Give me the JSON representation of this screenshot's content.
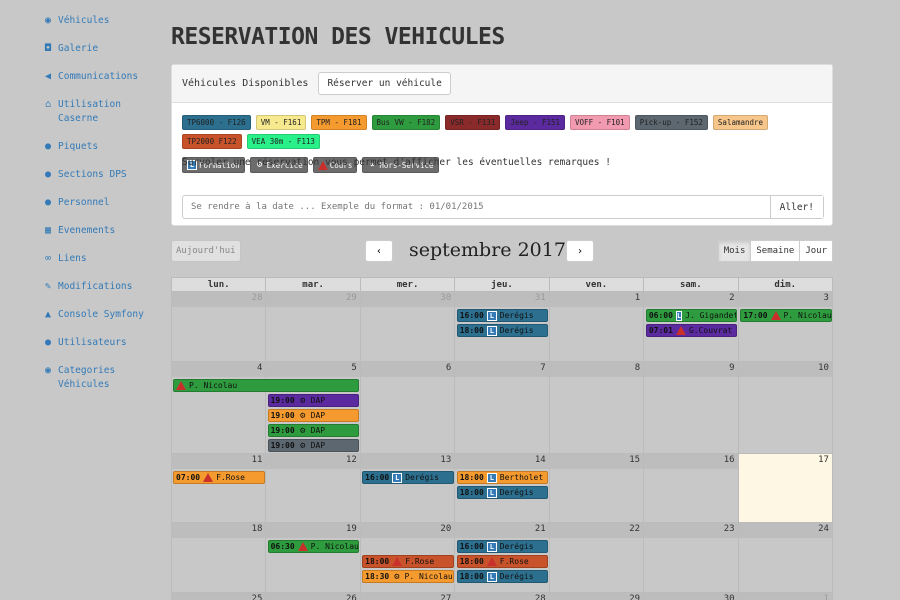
{
  "sidebar": {
    "items": [
      {
        "icon": "circle-icon",
        "glyph": "◉",
        "label": "Véhicules"
      },
      {
        "icon": "camera-icon",
        "glyph": "◘",
        "label": "Galerie"
      },
      {
        "icon": "bullhorn-icon",
        "glyph": "◀",
        "label": "Communications"
      },
      {
        "icon": "home-icon",
        "glyph": "⌂",
        "label": "Utilisation Caserne"
      },
      {
        "icon": "alert-icon",
        "glyph": "●",
        "label": "Piquets"
      },
      {
        "icon": "user-icon",
        "glyph": "●",
        "label": "Sections DPS"
      },
      {
        "icon": "user-icon",
        "glyph": "●",
        "label": "Personnel"
      },
      {
        "icon": "calendar-icon",
        "glyph": "▦",
        "label": "Evenements"
      },
      {
        "icon": "link-icon",
        "glyph": "∞",
        "label": "Liens"
      },
      {
        "icon": "pencil-icon",
        "glyph": "✎",
        "label": "Modifications"
      },
      {
        "icon": "road-icon",
        "glyph": "▲",
        "label": "Console Symfony"
      },
      {
        "icon": "user-icon",
        "glyph": "●",
        "label": "Utilisateurs"
      },
      {
        "icon": "circle-icon",
        "glyph": "◉",
        "label": "Categories Véhicules"
      }
    ]
  },
  "page": {
    "title": "RESERVATION DES VEHICULES"
  },
  "panel": {
    "title": "Véhicules Disponibles",
    "reserve_button": "Réserver un véhicule",
    "vehicles": [
      {
        "label": "TP6000 - F126",
        "color": "#2c6f8f"
      },
      {
        "label": "VM - F161",
        "color": "#f7e98e"
      },
      {
        "label": "TPM - F181",
        "color": "#f59a2e"
      },
      {
        "label": "Bus VW - F182",
        "color": "#2e9c3e"
      },
      {
        "label": "VSR - F131",
        "color": "#8b2a2a"
      },
      {
        "label": "Jeep - F151",
        "color": "#5b2a9e"
      },
      {
        "label": "VOFF - F101",
        "color": "#f29bb0"
      },
      {
        "label": "Pick-up - F152",
        "color": "#5c6770"
      },
      {
        "label": "Salamandre",
        "color": "#f7c68a"
      },
      {
        "label": "TP2000 F122",
        "color": "#c8532b"
      },
      {
        "label": "VEA 30m - F113",
        "color": "#2af08a"
      }
    ],
    "types": [
      {
        "label": "Formation",
        "icon": "L"
      },
      {
        "label": "Exercice",
        "icon": "gear"
      },
      {
        "label": "Cours",
        "icon": "tri"
      },
      {
        "label": "Hors-Service",
        "icon": "x"
      }
    ],
    "hint": "Survoler une réservation vous permet d'afficher les éventuelles remarques !",
    "goto_placeholder": "Se rendre à la date ... Exemple du format : 01/01/2015",
    "goto_button": "Aller!"
  },
  "toolbar": {
    "today": "Aujourd'hui",
    "prev": "‹",
    "next": "›",
    "month": "septembre 2017",
    "views": [
      "Mois",
      "Semaine",
      "Jour"
    ],
    "active_view": "Mois"
  },
  "calendar": {
    "weekdays": [
      "lun.",
      "mar.",
      "mer.",
      "jeu.",
      "ven.",
      "sam.",
      "dim."
    ],
    "weeks": [
      {
        "days": [
          "28",
          "29",
          "30",
          "31",
          "1",
          "2",
          "3"
        ],
        "other": [
          0,
          1,
          2,
          3
        ],
        "events": [
          {
            "day": 3,
            "row": 0,
            "span": 1,
            "time": "16:00",
            "icon": "L",
            "text": "Derégis",
            "color": "#2c6f8f"
          },
          {
            "day": 3,
            "row": 1,
            "span": 1,
            "time": "18:00",
            "icon": "L",
            "text": "Derégis",
            "color": "#2c6f8f"
          },
          {
            "day": 5,
            "row": 0,
            "span": 1,
            "time": "06:00",
            "icon": "L",
            "text": "J. Gigandet",
            "color": "#2e9c3e"
          },
          {
            "day": 5,
            "row": 1,
            "span": 1,
            "time": "07:01",
            "icon": "tri",
            "text": "G.Couvrat",
            "color": "#5b2a9e"
          },
          {
            "day": 6,
            "row": 0,
            "span": 1,
            "time": "17:00",
            "icon": "tri",
            "text": "P. Nicolau",
            "color": "#2e9c3e"
          }
        ]
      },
      {
        "days": [
          "4",
          "5",
          "6",
          "7",
          "8",
          "9",
          "10"
        ],
        "other": [],
        "events": [
          {
            "day": 0,
            "row": 0,
            "span": 2,
            "time": "",
            "icon": "tri",
            "text": "P. Nicolau",
            "color": "#2e9c3e"
          },
          {
            "day": 1,
            "row": 1,
            "span": 1,
            "time": "19:00",
            "icon": "gear",
            "text": "DAP",
            "color": "#5b2a9e"
          },
          {
            "day": 1,
            "row": 2,
            "span": 1,
            "time": "19:00",
            "icon": "gear",
            "text": "DAP",
            "color": "#f59a2e"
          },
          {
            "day": 1,
            "row": 3,
            "span": 1,
            "time": "19:00",
            "icon": "gear",
            "text": "DAP",
            "color": "#2e9c3e"
          },
          {
            "day": 1,
            "row": 4,
            "span": 1,
            "time": "19:00",
            "icon": "gear",
            "text": "DAP",
            "color": "#5c6770"
          }
        ]
      },
      {
        "days": [
          "11",
          "12",
          "13",
          "14",
          "15",
          "16",
          "17"
        ],
        "other": [],
        "highlight": 6,
        "events": [
          {
            "day": 0,
            "row": 0,
            "span": 1,
            "time": "07:00",
            "icon": "tri",
            "text": "F.Rose",
            "color": "#f59a2e"
          },
          {
            "day": 2,
            "row": 0,
            "span": 1,
            "time": "16:00",
            "icon": "L",
            "text": "Derégis",
            "color": "#2c6f8f"
          },
          {
            "day": 3,
            "row": 0,
            "span": 1,
            "time": "18:00",
            "icon": "L",
            "text": "Bertholet",
            "color": "#f59a2e"
          },
          {
            "day": 3,
            "row": 1,
            "span": 1,
            "time": "18:00",
            "icon": "L",
            "text": "Derégis",
            "color": "#2c6f8f"
          }
        ]
      },
      {
        "days": [
          "18",
          "19",
          "20",
          "21",
          "22",
          "23",
          "24"
        ],
        "other": [],
        "events": [
          {
            "day": 1,
            "row": 0,
            "span": 1,
            "time": "06:30",
            "icon": "tri",
            "text": "P. Nicolau",
            "color": "#2e9c3e"
          },
          {
            "day": 2,
            "row": 1,
            "span": 1,
            "time": "18:00",
            "icon": "tri",
            "text": "F.Rose",
            "color": "#c8532b"
          },
          {
            "day": 2,
            "row": 2,
            "span": 1,
            "time": "18:30",
            "icon": "gear",
            "text": "P. Nicolau",
            "color": "#f59a2e"
          },
          {
            "day": 3,
            "row": 0,
            "span": 1,
            "time": "16:00",
            "icon": "L",
            "text": "Derégis",
            "color": "#2c6f8f"
          },
          {
            "day": 3,
            "row": 1,
            "span": 1,
            "time": "18:00",
            "icon": "tri",
            "text": "F.Rose",
            "color": "#c8532b"
          },
          {
            "day": 3,
            "row": 2,
            "span": 1,
            "time": "18:00",
            "icon": "L",
            "text": "Derégis",
            "color": "#2c6f8f"
          }
        ]
      },
      {
        "days": [
          "25",
          "26",
          "27",
          "28",
          "29",
          "30",
          "1"
        ],
        "other": [
          6
        ],
        "events": []
      }
    ]
  }
}
